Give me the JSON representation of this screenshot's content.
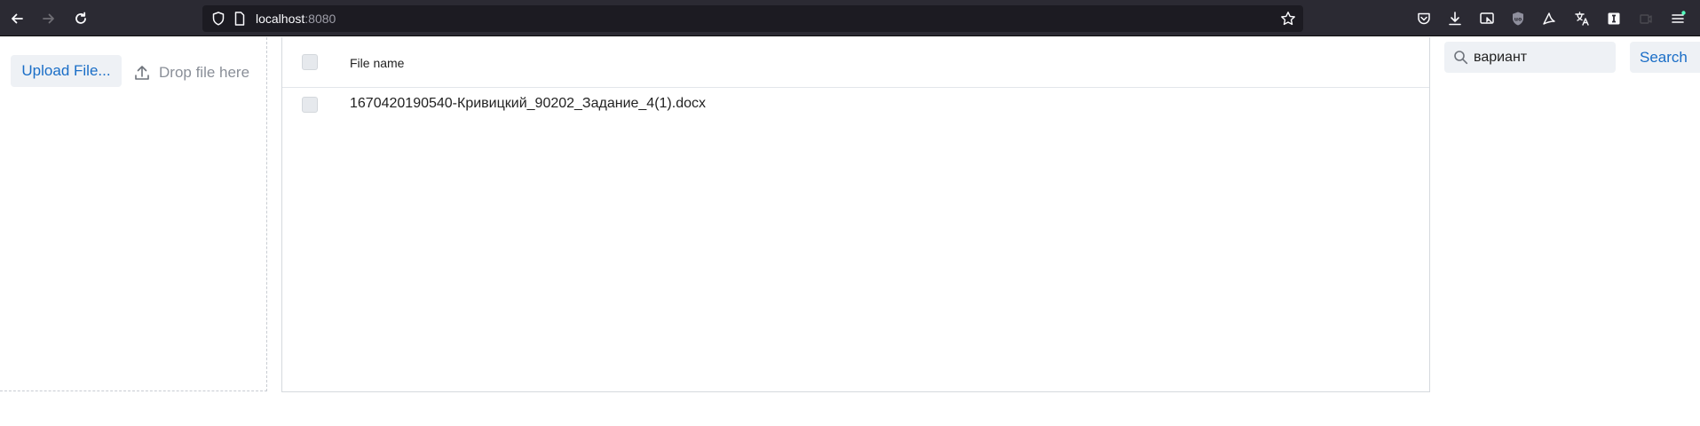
{
  "browser": {
    "url_host": "localhost",
    "url_port": ":8080",
    "nav_icons": [
      "back-icon",
      "forward-icon",
      "reload-icon"
    ],
    "url_icons": [
      "shield-icon",
      "page-icon",
      "bookmark-star-icon"
    ],
    "toolbar_icons": [
      "pocket-icon",
      "download-icon",
      "screenshot-icon",
      "ublock-icon",
      "acrobat-icon",
      "translate-icon",
      "extension-i-icon",
      "extension-dimmed-icon",
      "menu-icon"
    ]
  },
  "upload": {
    "button_label": "Upload File...",
    "drop_label": "Drop file here",
    "icon": "upload-icon"
  },
  "table": {
    "columns": [
      "File name"
    ],
    "rows": [
      {
        "name": "1670420190540-Кривицкий_90202_Задание_4(1).docx"
      }
    ]
  },
  "search": {
    "value": "вариант",
    "button_label": "Search",
    "icon": "search-icon"
  },
  "colors": {
    "toolbar_bg": "#2b2a33",
    "accent": "#1a6ec7",
    "control_bg": "#eef1f5"
  }
}
